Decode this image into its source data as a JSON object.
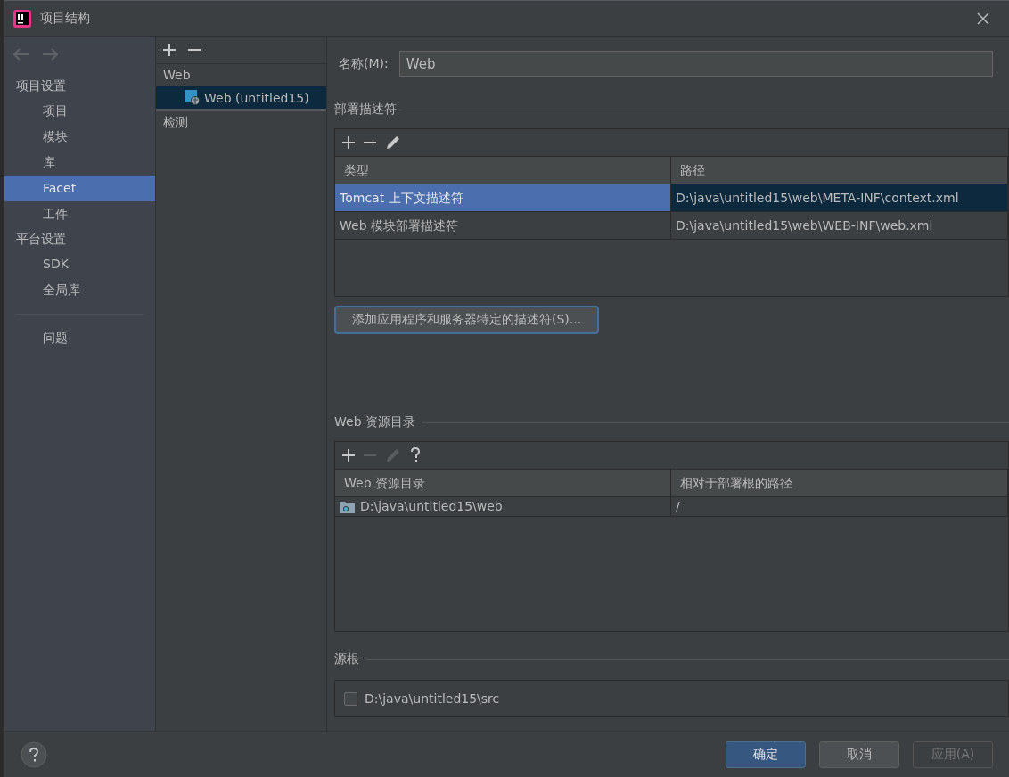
{
  "window": {
    "title": "项目结构"
  },
  "sidebar": {
    "items": [
      {
        "kind": "header",
        "label": "项目设置"
      },
      {
        "kind": "item",
        "label": "项目",
        "selected": false
      },
      {
        "kind": "item",
        "label": "模块",
        "selected": false
      },
      {
        "kind": "item",
        "label": "库",
        "selected": false
      },
      {
        "kind": "item",
        "label": "Facet",
        "selected": true
      },
      {
        "kind": "item",
        "label": "工件",
        "selected": false
      },
      {
        "kind": "header",
        "label": "平台设置"
      },
      {
        "kind": "item",
        "label": "SDK",
        "selected": false
      },
      {
        "kind": "item",
        "label": "全局库",
        "selected": false
      },
      {
        "kind": "separator"
      },
      {
        "kind": "item",
        "label": "问题",
        "selected": false
      }
    ]
  },
  "facets": {
    "tree": [
      {
        "label": "Web",
        "children": [
          {
            "label": "Web (untitled15)",
            "selected": true
          }
        ]
      },
      {
        "label": "检测"
      }
    ]
  },
  "name_field": {
    "label": "名称(M):",
    "value": "Web"
  },
  "deployment": {
    "title": "部署描述符",
    "toolbar": [
      {
        "kind": "add",
        "disabled": false
      },
      {
        "kind": "remove",
        "disabled": false
      },
      {
        "kind": "edit",
        "disabled": false
      }
    ],
    "columns": [
      "类型",
      "路径"
    ],
    "rows": [
      {
        "cells": [
          "Tomcat 上下文描述符",
          "D:\\java\\untitled15\\web\\META-INF\\context.xml"
        ],
        "selected": true
      },
      {
        "cells": [
          "Web 模块部署描述符",
          "D:\\java\\untitled15\\web\\WEB-INF\\web.xml"
        ],
        "selected": false
      }
    ],
    "add_button": "添加应用程序和服务器特定的描述符(S)..."
  },
  "resources": {
    "title": "Web 资源目录",
    "toolbar": [
      {
        "kind": "add",
        "disabled": false
      },
      {
        "kind": "remove",
        "disabled": true
      },
      {
        "kind": "edit",
        "disabled": true
      },
      {
        "kind": "help",
        "disabled": false
      }
    ],
    "columns": [
      "Web 资源目录",
      "相对于部署根的路径"
    ],
    "rows": [
      {
        "cells": [
          "D:\\java\\untitled15\\web",
          "/"
        ],
        "selected": false
      }
    ]
  },
  "source_roots": {
    "title": "源根",
    "items": [
      {
        "label": "D:\\java\\untitled15\\src",
        "checked": false
      }
    ]
  },
  "footer": {
    "help": true,
    "buttons": [
      {
        "label": "确定",
        "kind": "default",
        "disabled": false
      },
      {
        "label": "取消",
        "kind": "normal",
        "disabled": false
      },
      {
        "label": "应用(A)",
        "kind": "normal",
        "disabled": true
      }
    ]
  }
}
